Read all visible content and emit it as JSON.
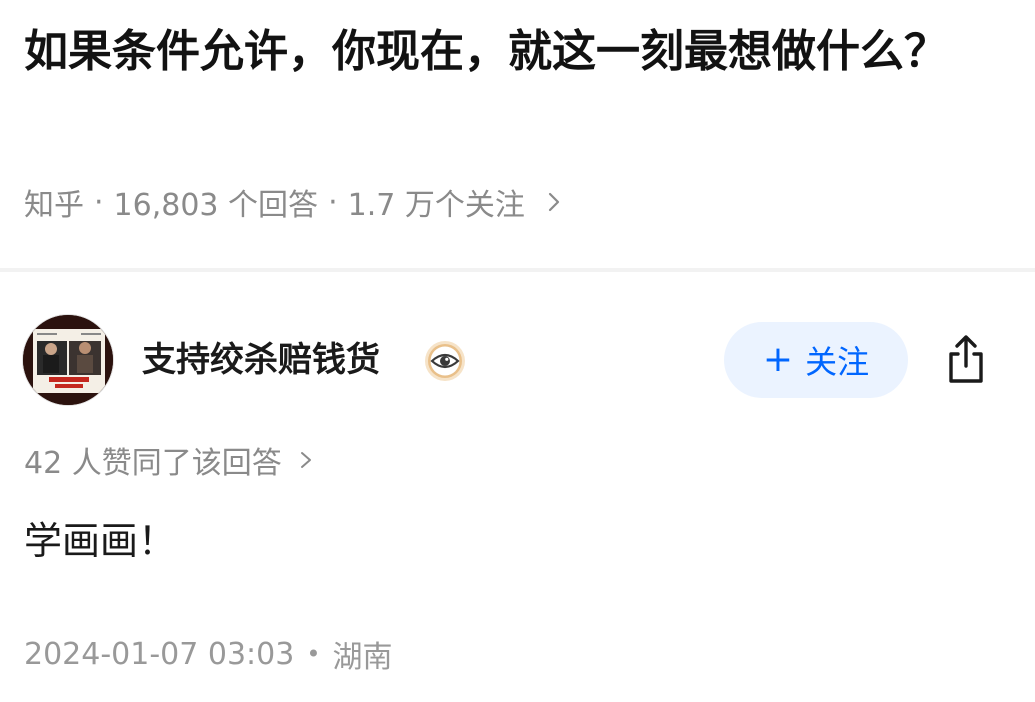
{
  "question": {
    "title": "如果条件允许，你现在，就这一刻最想做什么？"
  },
  "question_meta": {
    "source": "知乎",
    "separator": "·",
    "answers": "16,803 个回答",
    "followers": "1.7 万个关注"
  },
  "author": {
    "name": "支持绞杀赔钱货",
    "badge_icon": "eye-badge-icon",
    "avatar_icon": "movie-poster-avatar"
  },
  "actions": {
    "follow_plus": "+",
    "follow_label": "关注",
    "share_icon": "share-icon"
  },
  "answer": {
    "upvotes": "42 人赞同了该回答",
    "content": "学画画！",
    "timestamp": "2024-01-07 03:03",
    "dot": "•",
    "location": "湖南"
  },
  "colors": {
    "accent": "#0066ff",
    "follow_bg": "#ebf3ff",
    "muted_text": "#8a8a8a",
    "title_text": "#121212"
  }
}
